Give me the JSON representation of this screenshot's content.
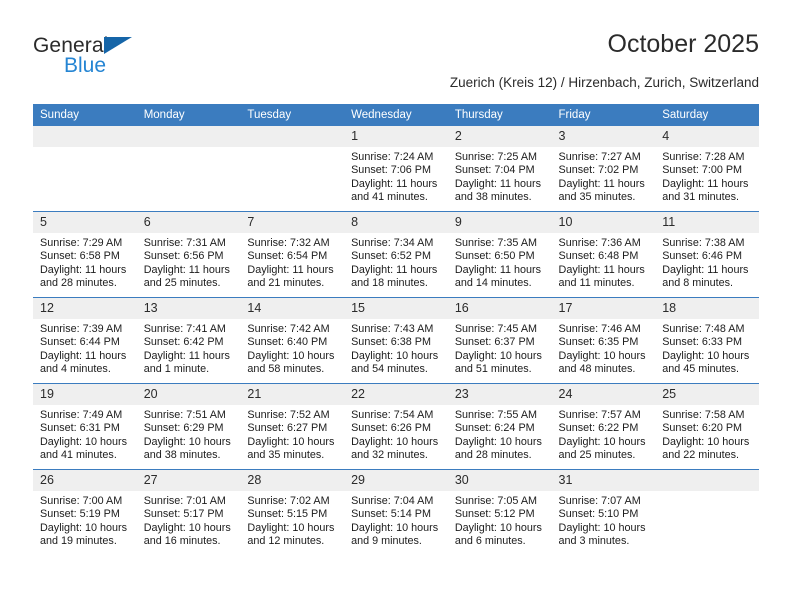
{
  "brand": {
    "name_primary": "General",
    "name_secondary": "Blue",
    "triangle_icon": "triangle-icon",
    "accent_color": "#2585d3",
    "logo_dark_color": "#2b2b2b"
  },
  "header": {
    "title": "October 2025",
    "subtitle": "Zuerich (Kreis 12) / Hirzenbach, Zurich, Switzerland"
  },
  "theme": {
    "header_row_bg": "#3b7cbf",
    "header_row_text": "#ffffff",
    "daynum_bg": "#efefef",
    "cell_bg": "#ffffff",
    "row_divider": "#3b7cbf"
  },
  "calendar": {
    "weekday_headers": [
      "Sunday",
      "Monday",
      "Tuesday",
      "Wednesday",
      "Thursday",
      "Friday",
      "Saturday"
    ],
    "weeks": [
      [
        {
          "day": "",
          "empty": true,
          "sunrise": "",
          "sunset": "",
          "daylight": ""
        },
        {
          "day": "",
          "empty": true,
          "sunrise": "",
          "sunset": "",
          "daylight": ""
        },
        {
          "day": "",
          "empty": true,
          "sunrise": "",
          "sunset": "",
          "daylight": ""
        },
        {
          "day": "1",
          "empty": false,
          "sunrise": "Sunrise: 7:24 AM",
          "sunset": "Sunset: 7:06 PM",
          "daylight": "Daylight: 11 hours and 41 minutes."
        },
        {
          "day": "2",
          "empty": false,
          "sunrise": "Sunrise: 7:25 AM",
          "sunset": "Sunset: 7:04 PM",
          "daylight": "Daylight: 11 hours and 38 minutes."
        },
        {
          "day": "3",
          "empty": false,
          "sunrise": "Sunrise: 7:27 AM",
          "sunset": "Sunset: 7:02 PM",
          "daylight": "Daylight: 11 hours and 35 minutes."
        },
        {
          "day": "4",
          "empty": false,
          "sunrise": "Sunrise: 7:28 AM",
          "sunset": "Sunset: 7:00 PM",
          "daylight": "Daylight: 11 hours and 31 minutes."
        }
      ],
      [
        {
          "day": "5",
          "empty": false,
          "sunrise": "Sunrise: 7:29 AM",
          "sunset": "Sunset: 6:58 PM",
          "daylight": "Daylight: 11 hours and 28 minutes."
        },
        {
          "day": "6",
          "empty": false,
          "sunrise": "Sunrise: 7:31 AM",
          "sunset": "Sunset: 6:56 PM",
          "daylight": "Daylight: 11 hours and 25 minutes."
        },
        {
          "day": "7",
          "empty": false,
          "sunrise": "Sunrise: 7:32 AM",
          "sunset": "Sunset: 6:54 PM",
          "daylight": "Daylight: 11 hours and 21 minutes."
        },
        {
          "day": "8",
          "empty": false,
          "sunrise": "Sunrise: 7:34 AM",
          "sunset": "Sunset: 6:52 PM",
          "daylight": "Daylight: 11 hours and 18 minutes."
        },
        {
          "day": "9",
          "empty": false,
          "sunrise": "Sunrise: 7:35 AM",
          "sunset": "Sunset: 6:50 PM",
          "daylight": "Daylight: 11 hours and 14 minutes."
        },
        {
          "day": "10",
          "empty": false,
          "sunrise": "Sunrise: 7:36 AM",
          "sunset": "Sunset: 6:48 PM",
          "daylight": "Daylight: 11 hours and 11 minutes."
        },
        {
          "day": "11",
          "empty": false,
          "sunrise": "Sunrise: 7:38 AM",
          "sunset": "Sunset: 6:46 PM",
          "daylight": "Daylight: 11 hours and 8 minutes."
        }
      ],
      [
        {
          "day": "12",
          "empty": false,
          "sunrise": "Sunrise: 7:39 AM",
          "sunset": "Sunset: 6:44 PM",
          "daylight": "Daylight: 11 hours and 4 minutes."
        },
        {
          "day": "13",
          "empty": false,
          "sunrise": "Sunrise: 7:41 AM",
          "sunset": "Sunset: 6:42 PM",
          "daylight": "Daylight: 11 hours and 1 minute."
        },
        {
          "day": "14",
          "empty": false,
          "sunrise": "Sunrise: 7:42 AM",
          "sunset": "Sunset: 6:40 PM",
          "daylight": "Daylight: 10 hours and 58 minutes."
        },
        {
          "day": "15",
          "empty": false,
          "sunrise": "Sunrise: 7:43 AM",
          "sunset": "Sunset: 6:38 PM",
          "daylight": "Daylight: 10 hours and 54 minutes."
        },
        {
          "day": "16",
          "empty": false,
          "sunrise": "Sunrise: 7:45 AM",
          "sunset": "Sunset: 6:37 PM",
          "daylight": "Daylight: 10 hours and 51 minutes."
        },
        {
          "day": "17",
          "empty": false,
          "sunrise": "Sunrise: 7:46 AM",
          "sunset": "Sunset: 6:35 PM",
          "daylight": "Daylight: 10 hours and 48 minutes."
        },
        {
          "day": "18",
          "empty": false,
          "sunrise": "Sunrise: 7:48 AM",
          "sunset": "Sunset: 6:33 PM",
          "daylight": "Daylight: 10 hours and 45 minutes."
        }
      ],
      [
        {
          "day": "19",
          "empty": false,
          "sunrise": "Sunrise: 7:49 AM",
          "sunset": "Sunset: 6:31 PM",
          "daylight": "Daylight: 10 hours and 41 minutes."
        },
        {
          "day": "20",
          "empty": false,
          "sunrise": "Sunrise: 7:51 AM",
          "sunset": "Sunset: 6:29 PM",
          "daylight": "Daylight: 10 hours and 38 minutes."
        },
        {
          "day": "21",
          "empty": false,
          "sunrise": "Sunrise: 7:52 AM",
          "sunset": "Sunset: 6:27 PM",
          "daylight": "Daylight: 10 hours and 35 minutes."
        },
        {
          "day": "22",
          "empty": false,
          "sunrise": "Sunrise: 7:54 AM",
          "sunset": "Sunset: 6:26 PM",
          "daylight": "Daylight: 10 hours and 32 minutes."
        },
        {
          "day": "23",
          "empty": false,
          "sunrise": "Sunrise: 7:55 AM",
          "sunset": "Sunset: 6:24 PM",
          "daylight": "Daylight: 10 hours and 28 minutes."
        },
        {
          "day": "24",
          "empty": false,
          "sunrise": "Sunrise: 7:57 AM",
          "sunset": "Sunset: 6:22 PM",
          "daylight": "Daylight: 10 hours and 25 minutes."
        },
        {
          "day": "25",
          "empty": false,
          "sunrise": "Sunrise: 7:58 AM",
          "sunset": "Sunset: 6:20 PM",
          "daylight": "Daylight: 10 hours and 22 minutes."
        }
      ],
      [
        {
          "day": "26",
          "empty": false,
          "sunrise": "Sunrise: 7:00 AM",
          "sunset": "Sunset: 5:19 PM",
          "daylight": "Daylight: 10 hours and 19 minutes."
        },
        {
          "day": "27",
          "empty": false,
          "sunrise": "Sunrise: 7:01 AM",
          "sunset": "Sunset: 5:17 PM",
          "daylight": "Daylight: 10 hours and 16 minutes."
        },
        {
          "day": "28",
          "empty": false,
          "sunrise": "Sunrise: 7:02 AM",
          "sunset": "Sunset: 5:15 PM",
          "daylight": "Daylight: 10 hours and 12 minutes."
        },
        {
          "day": "29",
          "empty": false,
          "sunrise": "Sunrise: 7:04 AM",
          "sunset": "Sunset: 5:14 PM",
          "daylight": "Daylight: 10 hours and 9 minutes."
        },
        {
          "day": "30",
          "empty": false,
          "sunrise": "Sunrise: 7:05 AM",
          "sunset": "Sunset: 5:12 PM",
          "daylight": "Daylight: 10 hours and 6 minutes."
        },
        {
          "day": "31",
          "empty": false,
          "sunrise": "Sunrise: 7:07 AM",
          "sunset": "Sunset: 5:10 PM",
          "daylight": "Daylight: 10 hours and 3 minutes."
        },
        {
          "day": "",
          "empty": true,
          "sunrise": "",
          "sunset": "",
          "daylight": ""
        }
      ]
    ]
  }
}
